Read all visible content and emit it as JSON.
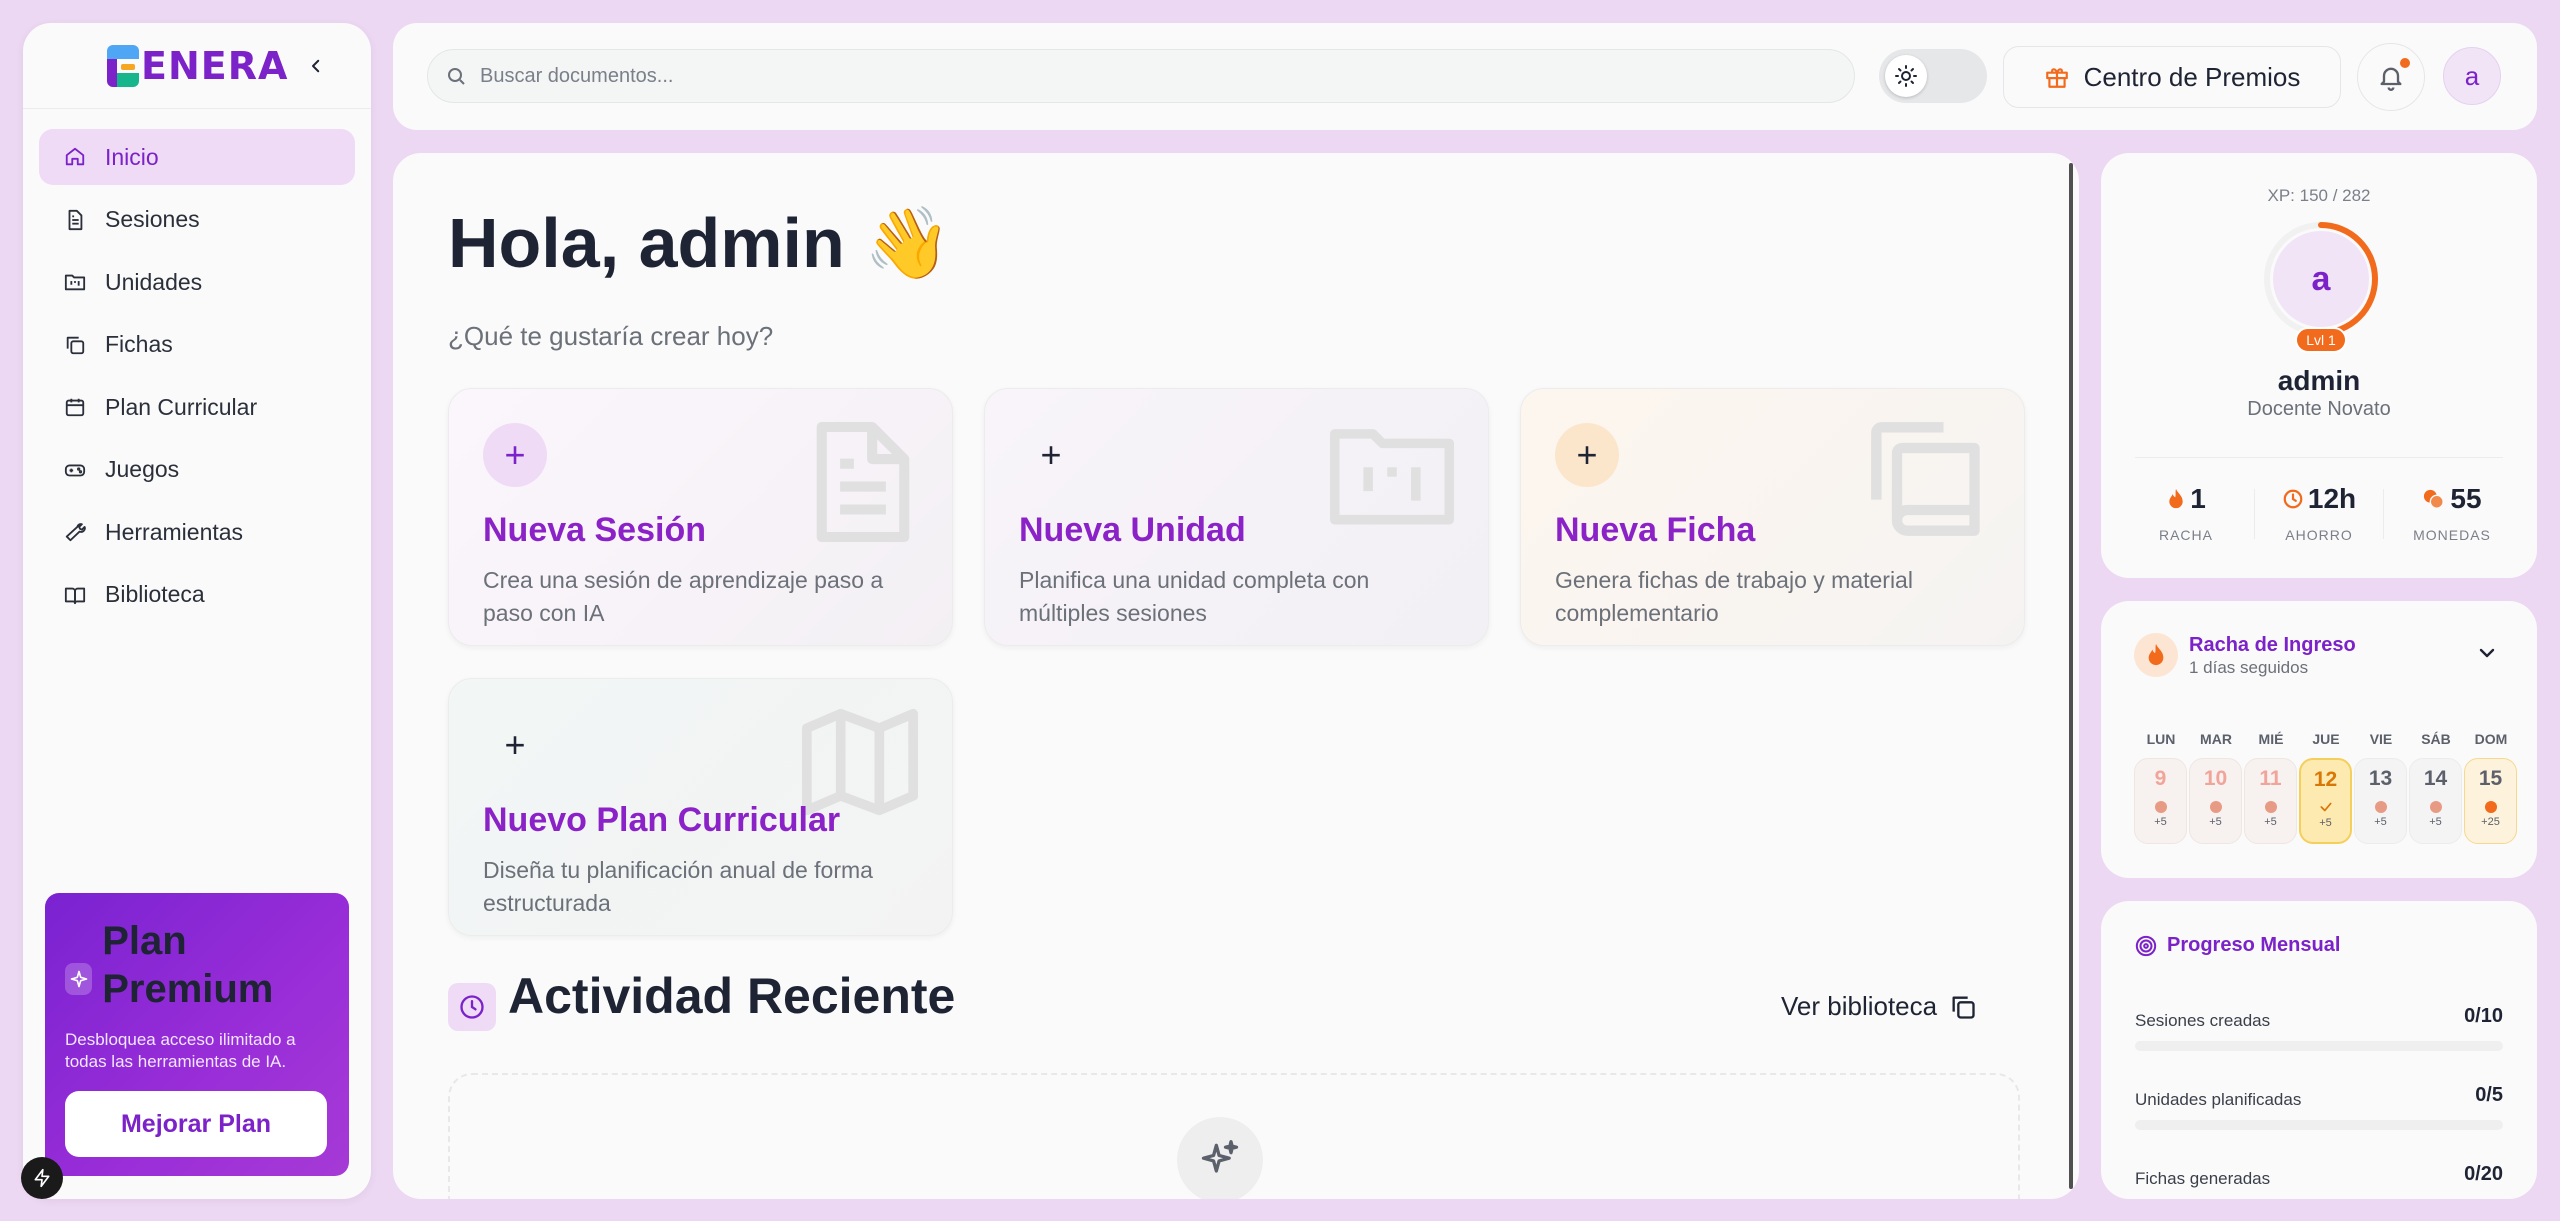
{
  "app": {
    "logo_text": "ENERA"
  },
  "sidebar": {
    "items": [
      {
        "label": "Inicio",
        "icon": "home-icon",
        "active": true
      },
      {
        "label": "Sesiones",
        "icon": "document-icon"
      },
      {
        "label": "Unidades",
        "icon": "folder-kanban-icon"
      },
      {
        "label": "Fichas",
        "icon": "copy-icon"
      },
      {
        "label": "Plan Curricular",
        "icon": "calendar-icon"
      },
      {
        "label": "Juegos",
        "icon": "gamepad-icon"
      },
      {
        "label": "Herramientas",
        "icon": "wrench-icon"
      },
      {
        "label": "Biblioteca",
        "icon": "book-open-icon"
      }
    ],
    "premium": {
      "title": "Plan Premium",
      "description": "Desbloquea acceso ilimitado a todas las herramientas de IA.",
      "button": "Mejorar Plan"
    }
  },
  "topbar": {
    "search_placeholder": "Buscar documentos...",
    "rewards_label": "Centro de Premios",
    "avatar_letter": "a"
  },
  "main": {
    "greeting": "Hola, admin 👋",
    "subtitle": "¿Qué te gustaría crear hoy?",
    "cards": [
      {
        "title": "Nueva Sesión",
        "description": "Crea una sesión de aprendizaje paso a paso con IA",
        "icon": "document-icon"
      },
      {
        "title": "Nueva Unidad",
        "description": "Planifica una unidad completa con múltiples sesiones",
        "icon": "folder-kanban-icon"
      },
      {
        "title": "Nueva Ficha",
        "description": "Genera fichas de trabajo y material complementario",
        "icon": "book-copy-icon"
      },
      {
        "title": "Nuevo Plan Curricular",
        "description": "Diseña tu planificación anual de forma estructurada",
        "icon": "map-icon"
      }
    ],
    "recent": {
      "title": "Actividad Reciente",
      "link": "Ver biblioteca"
    }
  },
  "profile": {
    "xp": "XP: 150 / 282",
    "xp_fraction": 0.53,
    "avatar_letter": "a",
    "level": "Lvl 1",
    "name": "admin",
    "role": "Docente Novato",
    "stats": [
      {
        "value": "1",
        "label": "RACHA",
        "icon": "flame-icon",
        "color": "#f26a1b"
      },
      {
        "value": "12h",
        "label": "AHORRO",
        "icon": "clock-icon",
        "color": "#f26a1b"
      },
      {
        "value": "55",
        "label": "MONEDAS",
        "icon": "coins-icon",
        "color": "#f26a1b"
      }
    ]
  },
  "streak": {
    "title": "Racha de Ingreso",
    "subtitle": "1 días seguidos",
    "days": [
      {
        "name": "LUN",
        "num": "9",
        "points": "+5",
        "state": "past"
      },
      {
        "name": "MAR",
        "num": "10",
        "points": "+5",
        "state": "past"
      },
      {
        "name": "MIÉ",
        "num": "11",
        "points": "+5",
        "state": "past"
      },
      {
        "name": "JUE",
        "num": "12",
        "points": "+5",
        "state": "today"
      },
      {
        "name": "VIE",
        "num": "13",
        "points": "+5",
        "state": "future"
      },
      {
        "name": "SÁB",
        "num": "14",
        "points": "+5",
        "state": "future"
      },
      {
        "name": "DOM",
        "num": "15",
        "points": "+25",
        "state": "bonus"
      }
    ]
  },
  "progress": {
    "title": "Progreso Mensual",
    "rows": [
      {
        "label": "Sesiones creadas",
        "value": "0/10",
        "fraction": 0
      },
      {
        "label": "Unidades planificadas",
        "value": "0/5",
        "fraction": 0
      },
      {
        "label": "Fichas generadas",
        "value": "0/20",
        "fraction": 0
      }
    ]
  },
  "colors": {
    "accent": "#7b22c8",
    "orange": "#f26a1b",
    "background": "#ecd8f2"
  }
}
